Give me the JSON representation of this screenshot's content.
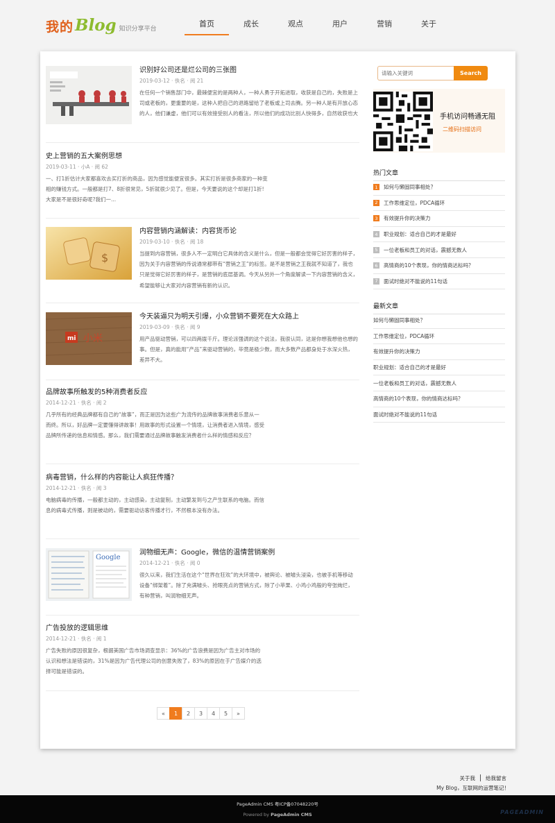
{
  "header": {
    "logo_cn": "我的",
    "logo_en": "Blog",
    "logo_sub": "知识分享平台",
    "nav": [
      "首页",
      "成长",
      "观点",
      "用户",
      "营销",
      "关于"
    ]
  },
  "posts": [
    {
      "title": "识别好公司还是烂公司的三张图",
      "meta": "2019-03-12 · 佚名 · 阅 21",
      "excerpt": "在任何一个销售部门中，最棘便宜的是两种人，一种人勇于开拓进取，收获是自己的，失败是上司或老板的，更重要的是，这种人把自己的退路留给了老板或上司去腾。另一种人是有开放心态的人，他们谦虚，他们可以有效接受别人的看法，所以他们的成功比别人快得多，自然收获也大",
      "thumb": "chart"
    },
    {
      "title": "史上营销的五大案例思想",
      "meta": "2019-03-11 · 小A · 阅 62",
      "excerpt": "一、打1折估计大家都喜欢去买打折的商品，因为感觉能便宜很多。其实打折是很多商家的一种变相的赚钱方式。一般都是打7、8折很常见，5折就很少见了。但是，今天要说的这个却是打1折!大家是不是很好奇呢?我们一..."
    },
    {
      "title": "内容营销内涵解读：内容货币论",
      "meta": "2019-03-10 · 佚名 · 阅 18",
      "excerpt": "当提到内容营销，很多人不一定明白它具体的含义是什么，但是一般都会觉得它好厉害的样子，因为关于内容营销的传说通常都带有“营销之王”的标签。是不是营销之王我就不知道了，我也只是觉得它好厉害的样子，是营销的底层基调。今天从另外一个角度解读一下内容营销的含义，希望能够让大家对内容营销有新的认识。",
      "thumb": "dice"
    },
    {
      "title": "今天装逼只为明天引爆，小众营销不要死在大众路上",
      "meta": "2019-03-09 · 佚名 · 阅 9",
      "excerpt": "用产品驱动营销，可以四两拨千斤。理论派强调的这个说法，我很认同，这是你想我想他也想的事。但是，真的能用“产品”来驱动营销的，毕竟是极少数，而大多数产品都身处于水深火热，差异不大。",
      "thumb": "wood",
      "thumb_text": "小米"
    },
    {
      "title": "品牌故事所触发的5种消费者反应",
      "meta": "2014-12-21 · 佚名 · 阅 2",
      "excerpt": "几乎所有的经典品牌都有自己的“故事”，而正是因为这些广为流传的品牌故事消费者乐意从一而终。所以，好品牌一定要懂得讲故事！用故事的形式设置一个情境，让消费者进入情境，感受品牌所传递的信息和情感。那么，我们需要通过品牌故事触发消费者什么样的情感和反应？"
    },
    {
      "title": "病毒营销，什么样的内容能让人疯狂传播？",
      "meta": "2014-12-21 · 佚名 · 阅 3",
      "excerpt": "电脑病毒的传播，一般都主动的，主动感染，主动复制，主动繁发到与之产生联系的电脑。而信息的病毒式传播，则是被动的，需要驱动访客传播才行，不然根本没有办法。"
    },
    {
      "title": "润物细无声：Google，微信的温情营销案例",
      "meta": "2014-12-21 · 佚名 · 阅 0",
      "excerpt": "很久以来，我们生活在这个“世界在狂欢”的大环境中，被舆论、被噱头浸染，也被手机等移动设备“绑架着”。除了充满噱头、抢眼亮点的营销方式，除了小苹果、小鸡小鸡般的夸张绚烂，有种营销，叫润物细无声。",
      "thumb": "google",
      "thumb_text": "Google"
    },
    {
      "title": "广告投放的逻辑思维",
      "meta": "2014-12-21 · 佚名 · 阅 1",
      "excerpt": "广告失败的原因很复杂，根据美国广告市场调查显示：36%的广告浪费是因为广告主对市场的认识和想法是错误的，31%是因为广告代理公司的创意失败了，83%的原因在于广告媒介的选择可能是错误的。"
    }
  ],
  "search": {
    "placeholder": "请输入关键词",
    "button": "Search"
  },
  "qr": {
    "line1": "手机访问畅通无阻",
    "line2": "二维码扫描访问"
  },
  "hot": {
    "title": "热门文章",
    "items": [
      {
        "num": "1",
        "text": "如何与懒固同事相处？"
      },
      {
        "num": "2",
        "text": "工作思维定位，PDCA循环"
      },
      {
        "num": "3",
        "text": "有效提升你的决策力"
      },
      {
        "num": "4",
        "text": "职业规划：适合自己的才是最好"
      },
      {
        "num": "5",
        "text": "一位老板和员工的对话，震撼无数人"
      },
      {
        "num": "6",
        "text": "高情商的10个表现，你的情商达标吗？"
      },
      {
        "num": "7",
        "text": "面试时绝对不能说的11句话"
      }
    ]
  },
  "latest": {
    "title": "最新文章",
    "items": [
      "如何与懒固同事相处？",
      "工作思维定位，PDCA循环",
      "有效提升你的决策力",
      "职业规划：适合自己的才是最好",
      "一位老板和员工的对话，震撼无数人",
      "高情商的10个表现，你的情商达标吗？",
      "面试时绝对不能说的11句话"
    ]
  },
  "pager": {
    "prev": "«",
    "pages": [
      "1",
      "2",
      "3",
      "4",
      "5"
    ],
    "next": "»",
    "current": "1"
  },
  "footer": {
    "about": "关于我",
    "message": "给我留言",
    "tagline": "My Blog，互联网的运营笔记！",
    "line1": "PageAdmin CMS 粤ICP备07048220号",
    "powered_prefix": "Powered by",
    "powered_name": "PageAdmin CMS",
    "logo": "PAGEADMIN"
  },
  "colors": {
    "accent": "#f07c1e",
    "logo_green": "#8dbb2f",
    "footer_bg": "#060606"
  }
}
